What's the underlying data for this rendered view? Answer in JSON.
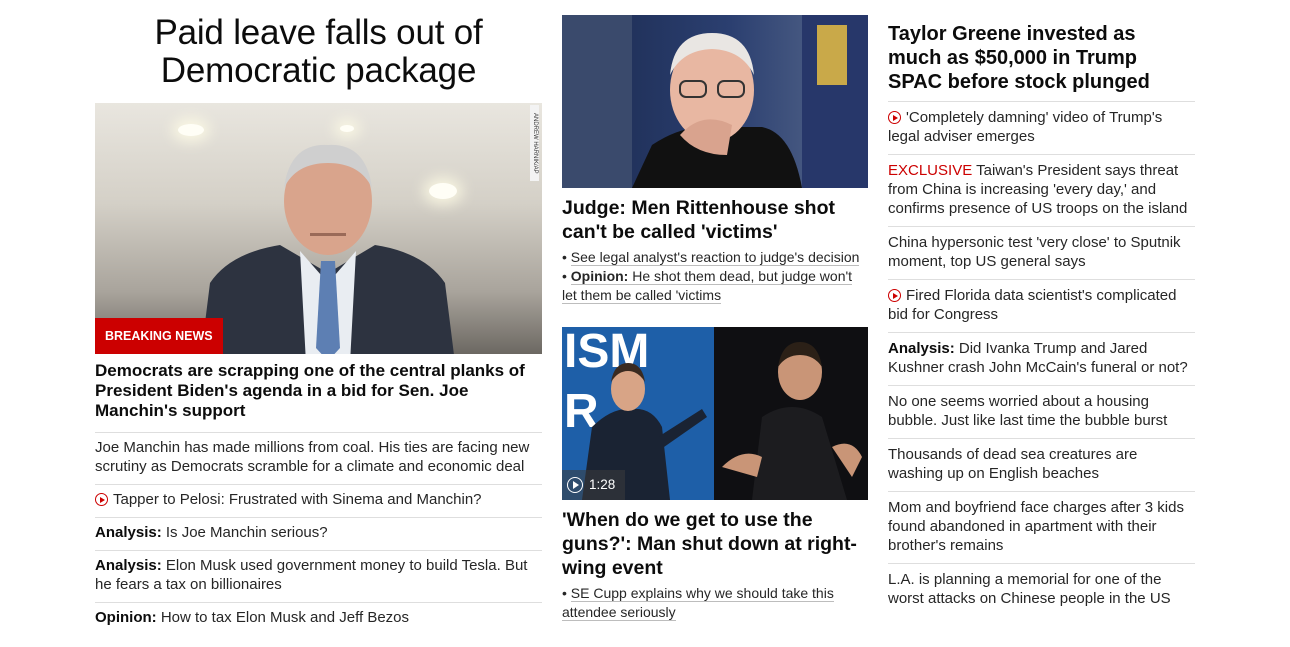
{
  "column1": {
    "headline": "Paid leave falls out of Democratic package",
    "photo_credit": "ANDREW HARNIK/AP",
    "breaking_label": "BREAKING NEWS",
    "lead_text": "Democrats are scrapping one of the central planks of President Biden's agenda in a bid for Sen. Joe Manchin's support",
    "items": [
      {
        "prefix": "",
        "text": "Joe Manchin has made millions from coal. His ties are facing new scrutiny as Democrats scramble for a climate and economic deal",
        "video": false
      },
      {
        "prefix": "",
        "text": "Tapper to Pelosi: Frustrated with Sinema and Manchin?",
        "video": true
      },
      {
        "prefix": "Analysis:",
        "text": " Is Joe Manchin serious?",
        "video": false
      },
      {
        "prefix": "Analysis:",
        "text": " Elon Musk used government money to build Tesla. But he fears a tax on billionaires",
        "video": false
      },
      {
        "prefix": "Opinion:",
        "text": " How to tax Elon Musk and Jeff Bezos",
        "video": false
      }
    ]
  },
  "column2": {
    "story1": {
      "headline": "Judge: Men Rittenhouse shot can't be called 'victims'",
      "bullet1": "See legal analyst's reaction to judge's decision",
      "bullet2_prefix": "Opinion:",
      "bullet2_text": " He shot them dead, but judge won't let them be called 'victims"
    },
    "story2": {
      "video_duration": "1:28",
      "headline": "'When do we get to use the guns?': Man shut down at right-wing event",
      "bullet1": "SE Cupp explains why we should take this attendee seriously"
    }
  },
  "column3": {
    "headline": "Taylor Greene invested as much as $50,000 in Trump SPAC before stock plunged",
    "items": [
      {
        "prefix": "",
        "tag": "",
        "text": "'Completely damning' video of Trump's legal adviser emerges",
        "video": true
      },
      {
        "prefix": "",
        "tag": "EXCLUSIVE",
        "text": " Taiwan's President says threat from China is increasing 'every day,' and confirms presence of US troops on the island",
        "video": false
      },
      {
        "prefix": "",
        "tag": "",
        "text": "China hypersonic test 'very close' to Sputnik moment, top US general says",
        "video": false
      },
      {
        "prefix": "",
        "tag": "",
        "text": "Fired Florida data scientist's complicated bid for Congress",
        "video": true
      },
      {
        "prefix": "Analysis:",
        "tag": "",
        "text": " Did Ivanka Trump and Jared Kushner crash John McCain's funeral or not?",
        "video": false
      },
      {
        "prefix": "",
        "tag": "",
        "text": "No one seems worried about a housing bubble. Just like last time the bubble burst",
        "video": false
      },
      {
        "prefix": "",
        "tag": "",
        "text": "Thousands of dead sea creatures are washing up on English beaches",
        "video": false
      },
      {
        "prefix": "",
        "tag": "",
        "text": "Mom and boyfriend face charges after 3 kids found abandoned in apartment with their brother's remains",
        "video": false
      },
      {
        "prefix": "",
        "tag": "",
        "text": "L.A. is planning a memorial for one of the worst attacks on Chinese people in the US",
        "video": false
      }
    ]
  },
  "icons": {
    "play": "play-circle-icon",
    "video": "video-play-icon"
  },
  "colors": {
    "accent_red": "#cc0000",
    "text": "#0c0c0c",
    "divider": "#dedede"
  }
}
